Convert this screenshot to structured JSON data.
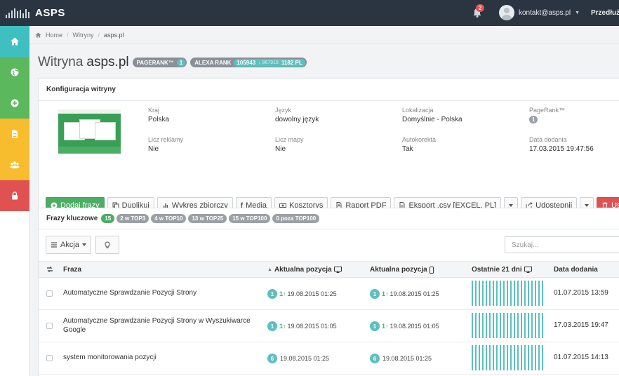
{
  "topbar": {
    "brand": "ASPS",
    "notifications_count": "2",
    "user_email": "kontakt@asps.pl",
    "extend_label": "Przedłuż"
  },
  "sidebar": {
    "items": [
      {
        "icon": "home-icon",
        "color": "#3fbfbf"
      },
      {
        "icon": "globe-icon",
        "color": "#5cb85c"
      },
      {
        "icon": "plus-circle-icon",
        "color": "#5cb85c"
      },
      {
        "icon": "document-icon",
        "color": "#f7bd2e"
      },
      {
        "icon": "users-icon",
        "color": "#f7bd2e"
      },
      {
        "icon": "lock-icon",
        "color": "#e05252"
      }
    ]
  },
  "breadcrumb": {
    "home": "Home",
    "sites": "Witryny",
    "current": "asps.pl"
  },
  "page": {
    "title_prefix": "Witryna",
    "title_domain": "asps.pl",
    "pagerank_label": "PAGERANK™",
    "pagerank_value": "1",
    "alexa_label": "ALEXA RANK",
    "alexa_world": "105943",
    "alexa_delta": "↓ 867918",
    "alexa_pl": "1182 PL"
  },
  "config": {
    "title": "Konfiguracja witryny",
    "fields": {
      "country_label": "Kraj",
      "country": "Polska",
      "language_label": "Język",
      "language": "dowolny język",
      "location_label": "Lokalizacja",
      "location": "Domyślnie - Polska",
      "pagerank_label": "PageRank™",
      "pagerank": "1",
      "ads_label": "Licz reklamy",
      "ads": "Nie",
      "maps_label": "Licz mapy",
      "maps": "Nie",
      "autocorrect_label": "Autokorekta",
      "autocorrect": "Tak",
      "added_label": "Data dodania",
      "added": "17.03.2015 19:47:56"
    },
    "buttons": {
      "add": "Dodaj frazy",
      "duplicate": "Duplikuj",
      "chart": "Wykres zbiorczy",
      "media": "Media",
      "costs": "Kosztorys",
      "pdf": "Raport PDF",
      "export": "Eksport .csv [EXCEL, PL]",
      "share": "Udostępnij",
      "delete": "Usuń"
    }
  },
  "keywords": {
    "title": "Frazy kluczowe",
    "tags": [
      "15",
      "2 w TOP3",
      "4 w TOP10",
      "13 w TOP25",
      "15 w TOP100",
      "0 poza TOP100"
    ],
    "action_label": "Akcja",
    "search_placeholder": "Szukaj...",
    "columns": {
      "phrase": "Fraza",
      "pos_desktop": "Aktualna pozycja",
      "pos_mobile": "Aktualna pozycja",
      "last21": "Ostatnie 21 dni",
      "added": "Data dodania"
    },
    "rows": [
      {
        "phrase": "Automatyczne Sprawdzanie Pozycji Strony",
        "desk_pos": "1",
        "desk_up": true,
        "desk_date": "19.08.2015 01:25",
        "mob_pos": "1",
        "mob_up": true,
        "mob_date": "19.08.2015 01:25",
        "added": "01.07.2015 13:59"
      },
      {
        "phrase": "Automatyczne Sprawdzanie Pozycji Strony w Wyszukiwarce Google",
        "desk_pos": "1",
        "desk_up": true,
        "desk_date": "19.08.2015 01:05",
        "mob_pos": "1",
        "mob_up": true,
        "mob_date": "19.08.2015 01:05",
        "added": "17.03.2015 19:47"
      },
      {
        "phrase": "system monitorowania pozycji",
        "desk_pos": "6",
        "desk_up": false,
        "desk_date": "19.08.2015 01:25",
        "mob_pos": "6",
        "mob_up": false,
        "mob_date": "19.08.2015 01:25",
        "added": "01.07.2015 14:13"
      }
    ]
  }
}
